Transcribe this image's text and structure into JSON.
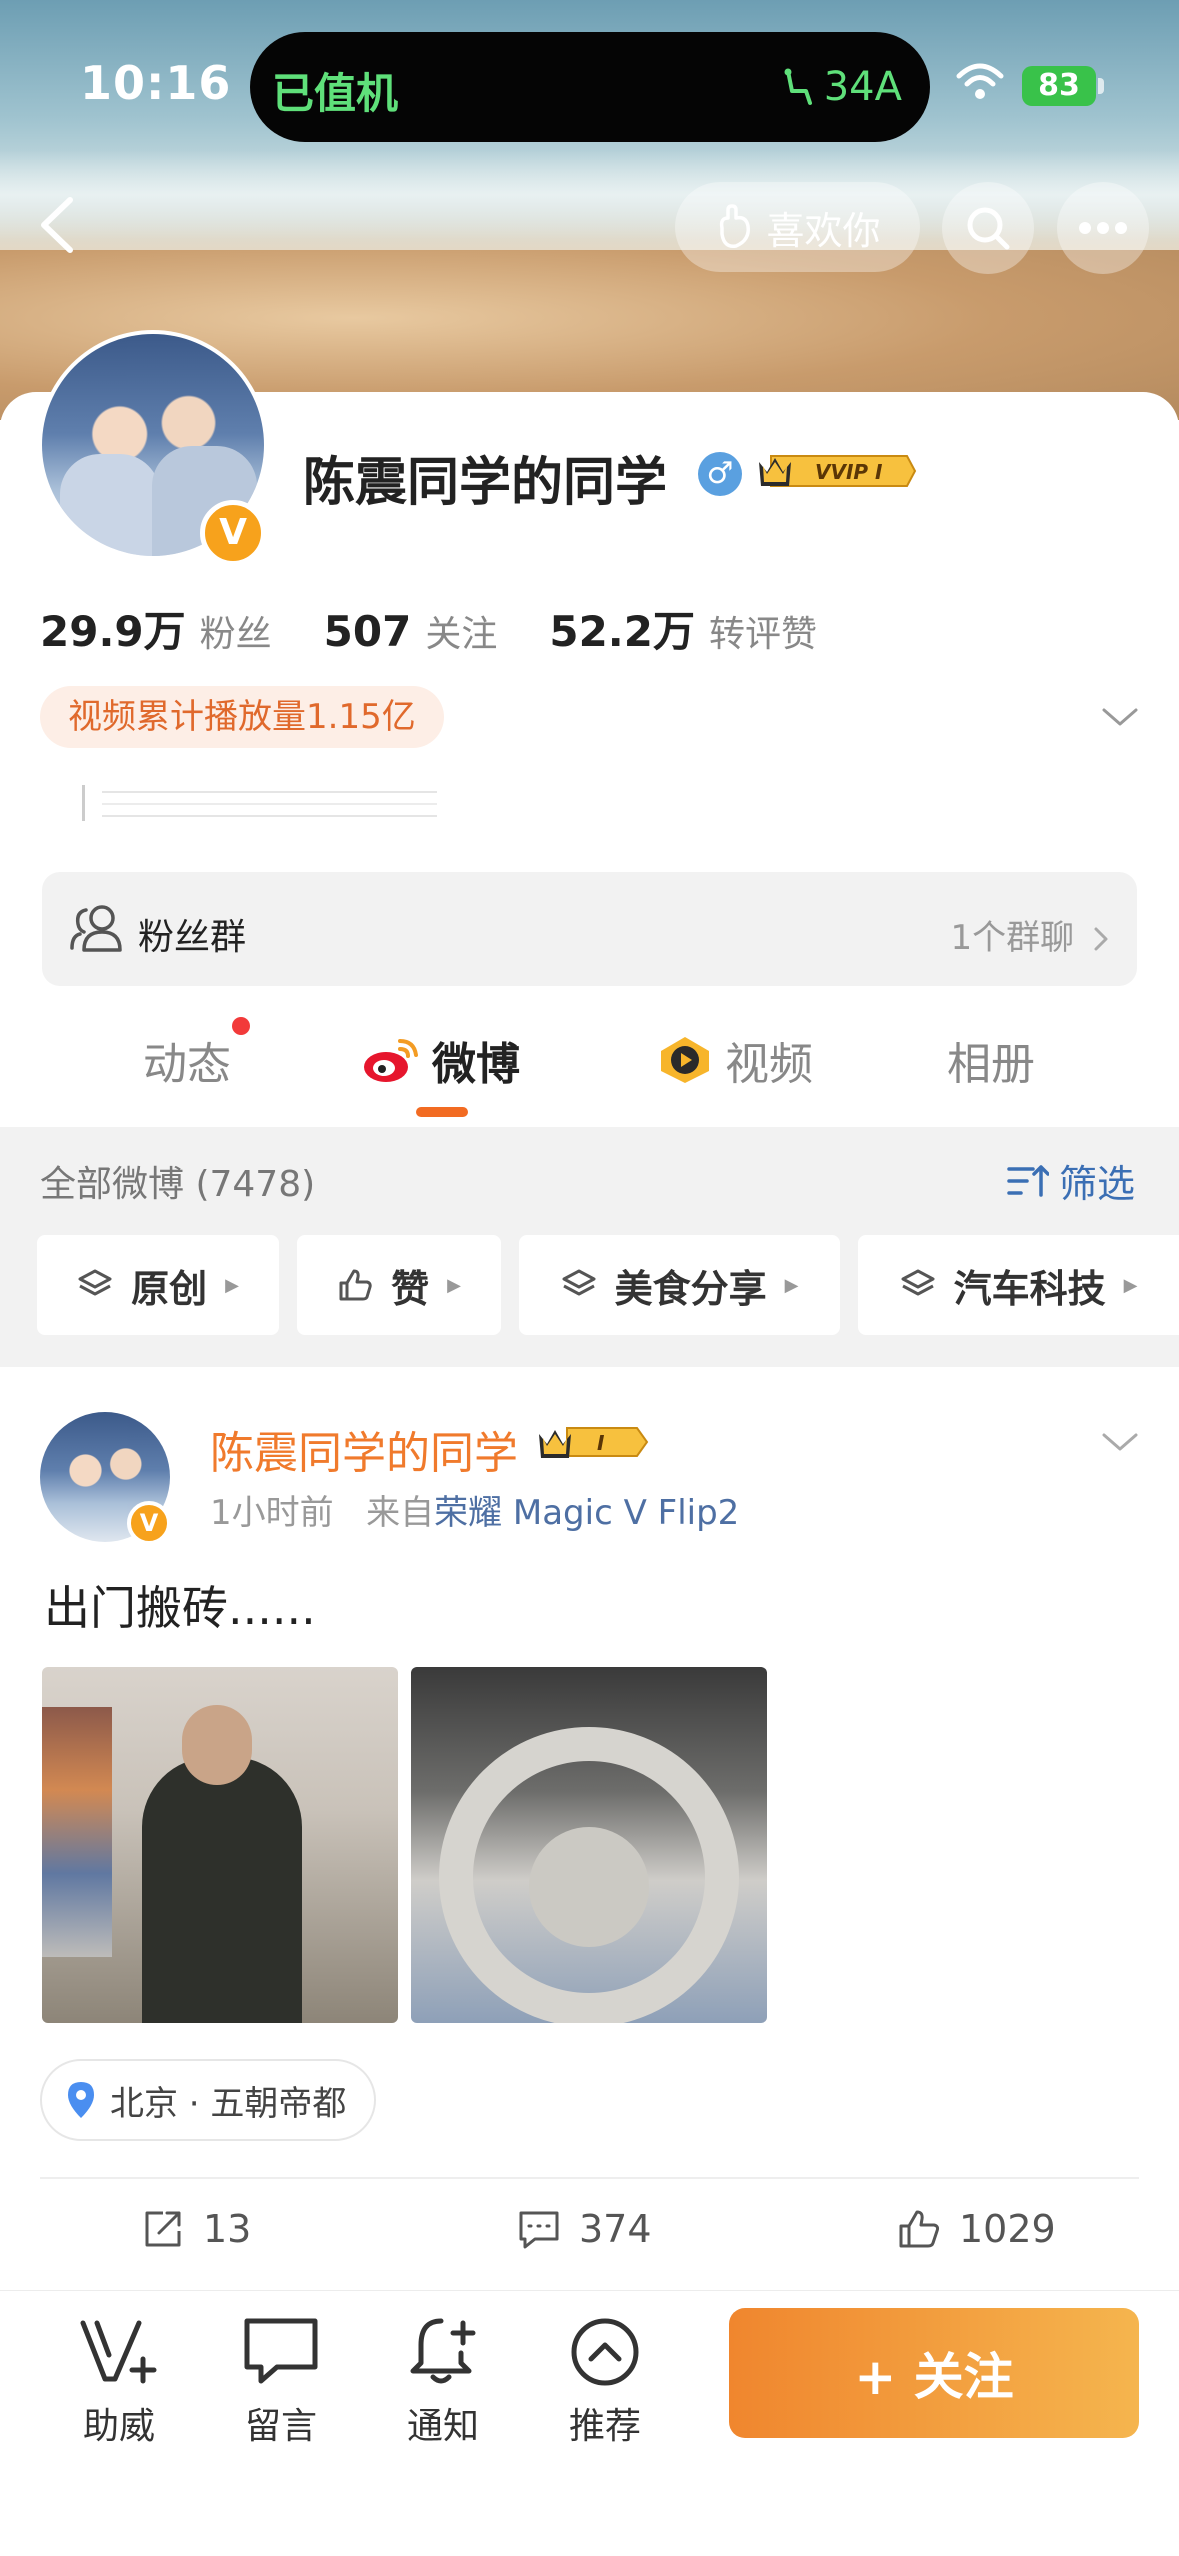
{
  "status_bar": {
    "time": "10:16",
    "island_left": "已值机",
    "island_right": "34A",
    "battery": "83"
  },
  "header": {
    "like_label": "喜欢你"
  },
  "profile": {
    "name": "陈震同学的同学",
    "verify_mark": "V",
    "gender_symbol": "♂",
    "vip_label": "VVIP I",
    "stats": {
      "fans_num": "29.9万",
      "fans_label": "粉丝",
      "following_num": "507",
      "following_label": "关注",
      "interact_num": "52.2万",
      "interact_label": "转评赞"
    },
    "video_tag": "视频累计播放量1.15亿",
    "fans_group": {
      "label": "粉丝群",
      "right": "1个群聊"
    }
  },
  "tabs": {
    "dynamic": "动态",
    "weibo": "微博",
    "video": "视频",
    "album": "相册"
  },
  "filter": {
    "title": "全部微博 (7478)",
    "button": "筛选",
    "chips": [
      "原创",
      "赞",
      "美食分享",
      "汽车科技"
    ]
  },
  "post": {
    "author": "陈震同学的同学",
    "vip_label": "I",
    "time": "1小时前",
    "from_prefix": "来自",
    "device": "荣耀 Magic V Flip2",
    "text": "出门搬砖......",
    "location": "北京 · 五朝帝都",
    "reposts": "13",
    "comments": "374",
    "likes": "1029"
  },
  "bottom_bar": {
    "items": [
      "助威",
      "留言",
      "通知",
      "推荐"
    ],
    "follow": "+ 关注"
  },
  "colors": {
    "accent": "#f26b22",
    "name_orange": "#f07a2c",
    "link_blue": "#3b6fb4",
    "status_green": "#5fe07a"
  }
}
